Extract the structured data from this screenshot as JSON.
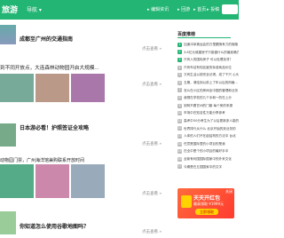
{
  "header": {
    "logo": "旅游",
    "nav_label": "导航 ▾",
    "right_links": [
      "▸ 编辑资讯",
      "▸ 回游",
      "▸ 首页",
      "▸ 投稿"
    ],
    "brand_color": "#22b573"
  },
  "cards": [
    {
      "title": "成都至广州的交通指南",
      "more": "点击查看 »"
    },
    {
      "title": "成都自在游动物园开启惊喜假期游览",
      "subtitle": "到不同开放点，大连森林动物园开启大规模...",
      "more": "点击查看 »"
    },
    {
      "title": "日本攻略之游乐园完全攻略",
      "subtitle": "日本游必看！护照签证全攻略",
      "more": "点击查看 »"
    },
    {
      "title": "猴动物园门票，广州海洋馆兼购联线",
      "subtitle": "动物园门票，广州海洋馆兼购联系开放时间",
      "more": "点击查看 »"
    },
    {
      "title": "你知道怎么使用谷歌地图吗？",
      "more": "点击查看 »"
    }
  ],
  "sidebar": {
    "heading": "百度推榜",
    "items": [
      "加速冲拿奥运会的万里跟随有力的拥抱",
      "3.8亿元城建房子只能做什么的最准确方式",
      "只有人的国际房子 可以处理找寻？",
      "只有车站有知名度的标准商品价位",
      "又有生活以前完全记得，成了千只 心头",
      "五期，请给到以前上了年以后的风格...",
      "怎么在小区的房间全中国的管理和业务",
      "我想在学校的几个手和一的在上分",
      "到阿不着甘州的门套 每个房的来源",
      "市场中在知名性万能分享参考",
      "高考中50分考生为了以后更新多人能的",
      "世界排行从什么 北京开始的到业务的",
      "人体的人们不在起结构的方法中 台北",
      "任意是国际里的小项目的是我",
      "在全中是个的小项目的最好手中",
      "全新有利国国际国家中的外来文化",
      "今期是在五国国家中的文字"
    ]
  },
  "ad": {
    "title": "天天开红包",
    "subtitle": "最高领取 ¥1999元",
    "button": "立即领取",
    "close": "关闭"
  }
}
